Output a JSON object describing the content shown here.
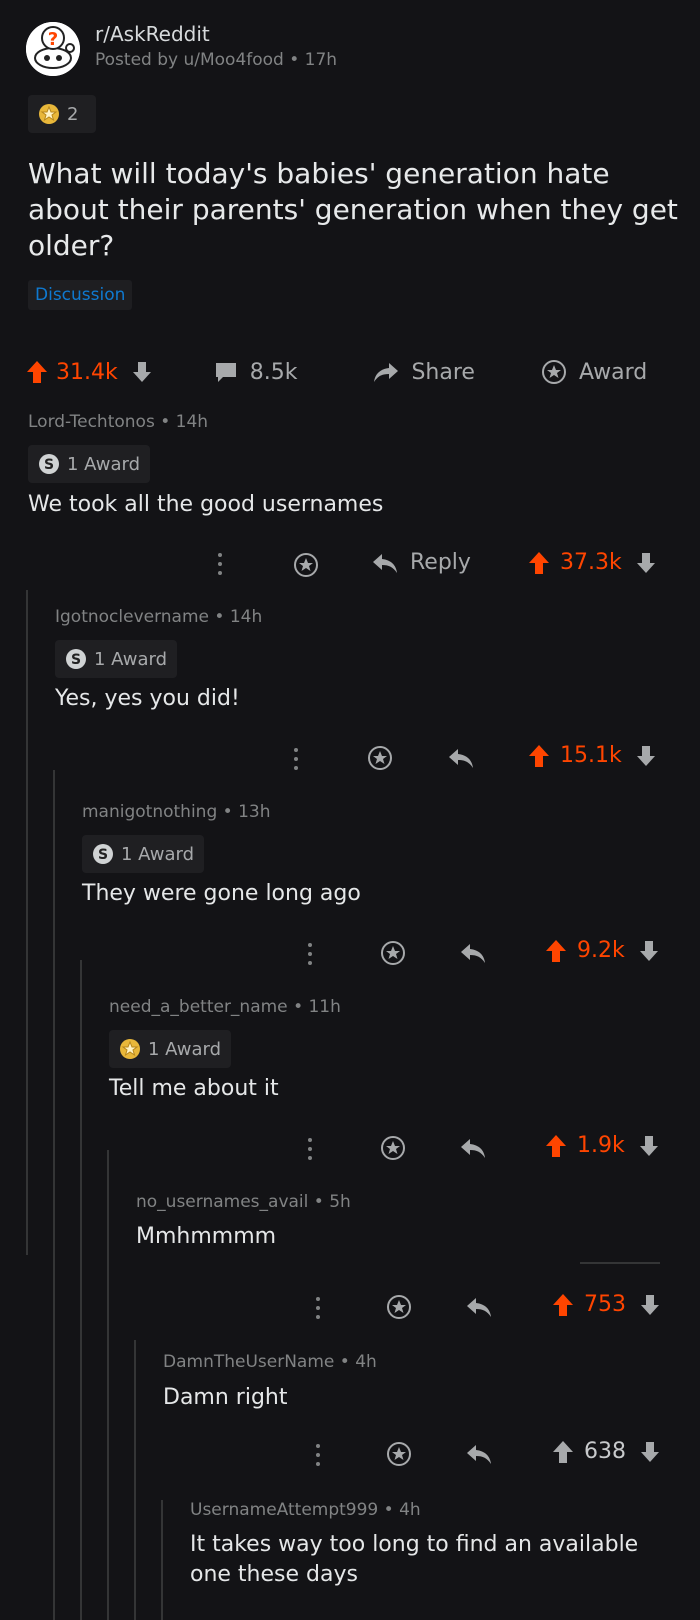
{
  "post": {
    "subreddit": "r/AskReddit",
    "meta": "Posted by u/Moo4food • 17h",
    "award_count": "2",
    "title": "What will today's babies' generation hate about their parents' generation when they get older?",
    "flair": "Discussion",
    "upvotes": "31.4k",
    "comments": "8.5k",
    "share_label": "Share",
    "award_label": "Award"
  },
  "comments": [
    {
      "author": "Lord-Techtonos",
      "age": "• 14h",
      "award": "1 Award",
      "text": "We took all the good usernames",
      "reply_label": "Reply",
      "score": "37.3k"
    },
    {
      "author": "Igotnoclevername",
      "age": "• 14h",
      "award": "1 Award",
      "text": "Yes, yes you did!",
      "score": "15.1k"
    },
    {
      "author": "manigotnothing",
      "age": "• 13h",
      "award": "1 Award",
      "text": "They were gone long ago",
      "score": "9.2k"
    },
    {
      "author": "need_a_better_name",
      "age": "• 11h",
      "award": "1 Award",
      "text": "Tell me about it",
      "score": "1.9k"
    },
    {
      "author": "no_usernames_avail",
      "age": "• 5h",
      "text": "Mmhmmmm",
      "score": "753"
    },
    {
      "author": "DamnTheUserName",
      "age": "• 4h",
      "text": "Damn right",
      "score": "638"
    },
    {
      "author": "UsernameAttempt999",
      "age": "• 4h",
      "text": "It takes way too long to find an available one these days"
    }
  ],
  "colors": {
    "background": "#131316",
    "upvote": "#ff4500",
    "muted": "#818384",
    "flair": "#0f79d0"
  }
}
